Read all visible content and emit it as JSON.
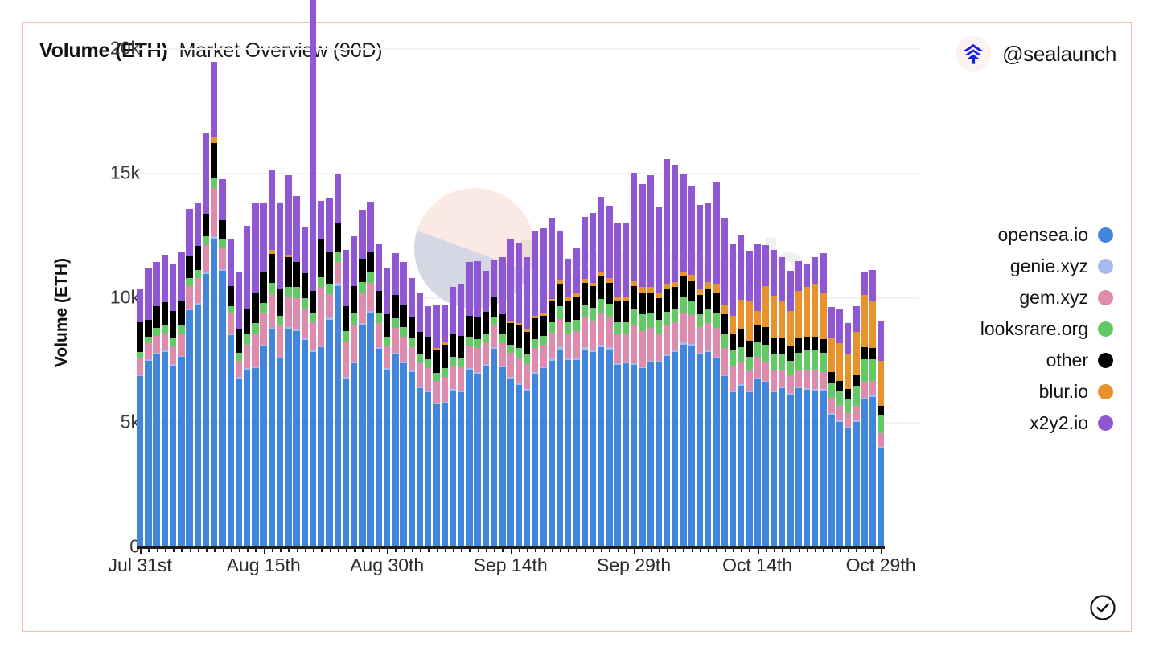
{
  "header": {
    "title_main": "Volume (ETH)",
    "title_sub": "Market Overview (90D)",
    "brand_handle": "@sealaunch",
    "logo_icon": "sealaunch-logo-icon"
  },
  "watermark": {
    "text": "Launch"
  },
  "footer": {
    "verified_icon": "verified-check-icon"
  },
  "legend": {
    "position": "right",
    "items": [
      {
        "label": "opensea.io",
        "color": "#4285DC"
      },
      {
        "label": "genie.xyz",
        "color": "#A7BAF0"
      },
      {
        "label": "gem.xyz",
        "color": "#DE8BAD"
      },
      {
        "label": "looksrare.org",
        "color": "#63C964"
      },
      {
        "label": "other",
        "color": "#000000"
      },
      {
        "label": "blur.io",
        "color": "#E8922E"
      },
      {
        "label": "x2y2.io",
        "color": "#9057D4"
      }
    ]
  },
  "chart_data": {
    "type": "bar",
    "stacked": true,
    "title": "Volume (ETH) Market Overview (90D)",
    "xlabel": "",
    "ylabel": "Volume (ETH)",
    "ylim": [
      0,
      21000
    ],
    "yticks": [
      0,
      5000,
      10000,
      15000,
      20000
    ],
    "ytick_labels": [
      "0",
      "5k",
      "10k",
      "15k",
      "20k"
    ],
    "grid": true,
    "xtick_labels": [
      "Jul 31st",
      "Aug 15th",
      "Aug 30th",
      "Sep 14th",
      "Sep 29th",
      "Oct 14th",
      "Oct 29th"
    ],
    "xtick_indices": [
      0,
      15,
      30,
      45,
      60,
      75,
      90
    ],
    "categories": [
      "Jul 31st",
      "Aug 1st",
      "Aug 2nd",
      "Aug 3rd",
      "Aug 4th",
      "Aug 5th",
      "Aug 6th",
      "Aug 7th",
      "Aug 8th",
      "Aug 9th",
      "Aug 10th",
      "Aug 11th",
      "Aug 12th",
      "Aug 13th",
      "Aug 14th",
      "Aug 15th",
      "Aug 16th",
      "Aug 17th",
      "Aug 18th",
      "Aug 19th",
      "Aug 20th",
      "Aug 21st",
      "Aug 22nd",
      "Aug 23rd",
      "Aug 24th",
      "Aug 25th",
      "Aug 26th",
      "Aug 27th",
      "Aug 28th",
      "Aug 29th",
      "Aug 30th",
      "Aug 31st",
      "Sep 1st",
      "Sep 2nd",
      "Sep 3rd",
      "Sep 4th",
      "Sep 5th",
      "Sep 6th",
      "Sep 7th",
      "Sep 8th",
      "Sep 9th",
      "Sep 10th",
      "Sep 11th",
      "Sep 12th",
      "Sep 13th",
      "Sep 14th",
      "Sep 15th",
      "Sep 16th",
      "Sep 17th",
      "Sep 18th",
      "Sep 19th",
      "Sep 20th",
      "Sep 21st",
      "Sep 22nd",
      "Sep 23rd",
      "Sep 24th",
      "Sep 25th",
      "Sep 26th",
      "Sep 27th",
      "Sep 28th",
      "Sep 29th",
      "Sep 30th",
      "Oct 1st",
      "Oct 2nd",
      "Oct 3rd",
      "Oct 4th",
      "Oct 5th",
      "Oct 6th",
      "Oct 7th",
      "Oct 8th",
      "Oct 9th",
      "Oct 10th",
      "Oct 11th",
      "Oct 12th",
      "Oct 13th",
      "Oct 14th",
      "Oct 15th",
      "Oct 16th",
      "Oct 17th",
      "Oct 18th",
      "Oct 19th",
      "Oct 20th",
      "Oct 21st",
      "Oct 22nd",
      "Oct 23rd",
      "Oct 24th",
      "Oct 25th",
      "Oct 26th",
      "Oct 27th",
      "Oct 28th",
      "Oct 29th"
    ],
    "series": [
      {
        "name": "opensea.io",
        "color": "#4285DC",
        "values": [
          6850,
          7450,
          7700,
          7800,
          7250,
          7600,
          9500,
          9700,
          10950,
          12350,
          11050,
          8500,
          6750,
          7100,
          7150,
          8050,
          8700,
          7550,
          8750,
          8650,
          8300,
          7800,
          8000,
          9100,
          10450,
          6750,
          7350,
          8900,
          9350,
          7950,
          7100,
          7700,
          7350,
          7000,
          6350,
          6200,
          5700,
          5750,
          6250,
          6200,
          7100,
          6950,
          7250,
          7950,
          7200,
          6750,
          6500,
          6250,
          6950,
          7150,
          7450,
          7900,
          7500,
          7500,
          7900,
          7800,
          8000,
          7900,
          7300,
          7350,
          7300,
          7150,
          7400,
          7400,
          7650,
          7800,
          8100,
          8050,
          7700,
          7800,
          7550,
          6850,
          6200,
          6450,
          6200,
          6700,
          6600,
          6200,
          6350,
          6100,
          6350,
          6300,
          6250,
          6250,
          5300,
          5000,
          4750,
          5000,
          5900,
          6000,
          3950
        ]
      },
      {
        "name": "genie.xyz",
        "color": "#A7BAF0",
        "values": [
          60,
          60,
          60,
          60,
          60,
          60,
          60,
          60,
          60,
          90,
          90,
          60,
          60,
          60,
          60,
          60,
          90,
          60,
          60,
          60,
          60,
          60,
          60,
          90,
          120,
          60,
          60,
          60,
          90,
          60,
          60,
          60,
          60,
          60,
          60,
          60,
          60,
          60,
          60,
          60,
          60,
          60,
          60,
          60,
          60,
          60,
          60,
          60,
          60,
          60,
          90,
          90,
          60,
          60,
          90,
          90,
          90,
          90,
          60,
          60,
          60,
          60,
          60,
          60,
          60,
          60,
          90,
          90,
          60,
          60,
          60,
          60,
          60,
          60,
          60,
          60,
          60,
          60,
          60,
          60,
          60,
          60,
          60,
          60,
          60,
          60,
          60,
          60,
          60,
          60,
          60
        ]
      },
      {
        "name": "gem.xyz",
        "color": "#DE8BAD",
        "values": [
          650,
          650,
          700,
          700,
          750,
          900,
          900,
          1000,
          1100,
          1950,
          850,
          800,
          650,
          950,
          1300,
          1250,
          1350,
          1250,
          1200,
          1250,
          1200,
          1150,
          2350,
          950,
          850,
          1400,
          1450,
          1200,
          1150,
          950,
          900,
          1000,
          1000,
          950,
          950,
          900,
          900,
          1000,
          950,
          950,
          900,
          950,
          900,
          850,
          900,
          950,
          1000,
          1000,
          950,
          900,
          1050,
          1150,
          1000,
          1100,
          1200,
          1150,
          1250,
          1200,
          1150,
          1100,
          1550,
          1450,
          1300,
          1100,
          1150,
          1150,
          1200,
          1150,
          1050,
          1100,
          1150,
          1050,
          1000,
          900,
          800,
          850,
          750,
          800,
          700,
          700,
          650,
          700,
          750,
          700,
          600,
          600,
          550,
          600,
          650,
          600,
          550
        ]
      },
      {
        "name": "looksrare.org",
        "color": "#63C964",
        "values": [
          250,
          250,
          300,
          300,
          300,
          300,
          300,
          350,
          350,
          400,
          350,
          300,
          300,
          400,
          450,
          400,
          450,
          400,
          400,
          450,
          400,
          350,
          400,
          400,
          400,
          450,
          500,
          450,
          400,
          400,
          350,
          400,
          400,
          350,
          350,
          350,
          300,
          350,
          350,
          350,
          350,
          350,
          350,
          350,
          350,
          350,
          400,
          400,
          350,
          350,
          400,
          500,
          450,
          450,
          500,
          550,
          600,
          550,
          500,
          500,
          600,
          650,
          600,
          550,
          550,
          550,
          600,
          550,
          500,
          550,
          600,
          600,
          600,
          600,
          550,
          600,
          700,
          650,
          600,
          600,
          700,
          800,
          800,
          750,
          600,
          600,
          550,
          800,
          900,
          850,
          700
        ]
      },
      {
        "name": "other",
        "color": "#000000",
        "values": [
          1200,
          700,
          900,
          950,
          1100,
          1000,
          900,
          950,
          900,
          1400,
          750,
          800,
          950,
          1050,
          1250,
          1250,
          1150,
          1100,
          1200,
          1000,
          1000,
          900,
          1550,
          1300,
          1150,
          1000,
          1100,
          950,
          850,
          900,
          900,
          950,
          900,
          850,
          900,
          900,
          900,
          950,
          900,
          900,
          850,
          900,
          850,
          800,
          800,
          850,
          900,
          900,
          850,
          800,
          850,
          900,
          850,
          900,
          900,
          850,
          900,
          850,
          850,
          850,
          950,
          900,
          850,
          850,
          900,
          850,
          850,
          800,
          800,
          800,
          800,
          750,
          700,
          700,
          650,
          700,
          700,
          650,
          650,
          600,
          600,
          550,
          550,
          550,
          450,
          400,
          400,
          450,
          500,
          450,
          400
        ]
      },
      {
        "name": "blur.io",
        "color": "#E8922E",
        "values": [
          0,
          0,
          0,
          0,
          0,
          0,
          0,
          0,
          0,
          250,
          0,
          0,
          0,
          0,
          0,
          0,
          150,
          0,
          100,
          0,
          0,
          0,
          0,
          0,
          0,
          0,
          0,
          0,
          0,
          0,
          0,
          0,
          0,
          0,
          0,
          0,
          100,
          100,
          0,
          0,
          0,
          0,
          0,
          0,
          0,
          100,
          100,
          100,
          100,
          100,
          100,
          150,
          150,
          150,
          150,
          150,
          150,
          200,
          150,
          150,
          200,
          200,
          200,
          200,
          200,
          200,
          200,
          250,
          250,
          300,
          350,
          400,
          700,
          1200,
          1600,
          550,
          1650,
          1700,
          1500,
          1400,
          1900,
          2000,
          2100,
          1900,
          1350,
          1500,
          1400,
          1700,
          2100,
          1900,
          1800
        ]
      },
      {
        "name": "x2y2.io",
        "color": "#9057D4",
        "values": [
          1300,
          2100,
          1750,
          1900,
          1850,
          1950,
          1900,
          1750,
          3250,
          3000,
          1650,
          1900,
          2300,
          3300,
          3600,
          2800,
          3250,
          3400,
          3200,
          2650,
          1850,
          20300,
          1500,
          2150,
          2000,
          2250,
          2000,
          1950,
          2000,
          1900,
          1900,
          1650,
          1700,
          1550,
          1600,
          1250,
          1750,
          1500,
          1900,
          2050,
          2150,
          2250,
          1650,
          1500,
          2300,
          3300,
          3250,
          2900,
          3400,
          3400,
          3250,
          2000,
          1550,
          1850,
          2500,
          2800,
          3050,
          2900,
          3000,
          2950,
          4350,
          4150,
          4500,
          3500,
          5050,
          4700,
          3900,
          3600,
          3350,
          3150,
          4150,
          3500,
          2900,
          2600,
          2000,
          2700,
          1650,
          1850,
          1750,
          1600,
          1200,
          950,
          1100,
          1550,
          1250,
          1350,
          1250,
          1050,
          900,
          1250,
          1600
        ]
      }
    ]
  }
}
